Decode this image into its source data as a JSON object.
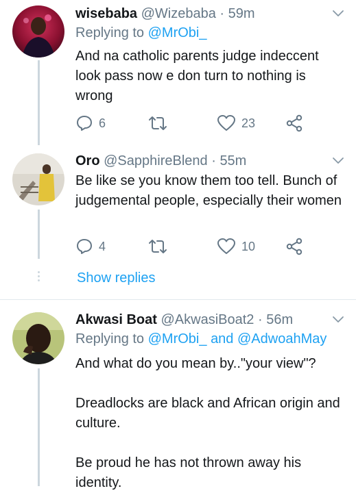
{
  "tweets": [
    {
      "name": "wisebaba",
      "handle": "@Wizebaba",
      "dot": "·",
      "time": "59m",
      "replying_prefix": "Replying to",
      "replying_mentions": [
        "@MrObi_"
      ],
      "text": [
        "And na catholic parents judge indeccent look pass now e don turn to nothing is wrong"
      ],
      "replies": "6",
      "retweets": "",
      "likes": "23"
    },
    {
      "name": "Oro",
      "handle": "@SapphireBlend",
      "dot": "·",
      "time": "55m",
      "text": [
        "Be like se you know them too tell. Bunch of judgemental people, especially their women"
      ],
      "replies": "4",
      "retweets": "",
      "likes": "10",
      "show_replies": "Show replies"
    },
    {
      "name": "Akwasi Boat",
      "handle": "@AkwasiBoat2",
      "dot": "·",
      "time": "56m",
      "replying_prefix": "Replying to",
      "replying_mentions": [
        "@MrObi_",
        "@AdwoahMay"
      ],
      "replying_joiner": "and",
      "text": [
        "And what do you mean by..\"your view\"?",
        "Dreadlocks are black and African origin and culture.",
        "Be proud he has not thrown away his identity."
      ]
    }
  ],
  "icons": {
    "reply": "reply-icon",
    "retweet": "retweet-icon",
    "like": "heart-icon",
    "share": "share-icon",
    "caret": "chevron-down-icon"
  },
  "colors": {
    "link": "#1da1f2",
    "muted": "#657786",
    "text": "#14171a",
    "line": "#ccd6dd"
  }
}
